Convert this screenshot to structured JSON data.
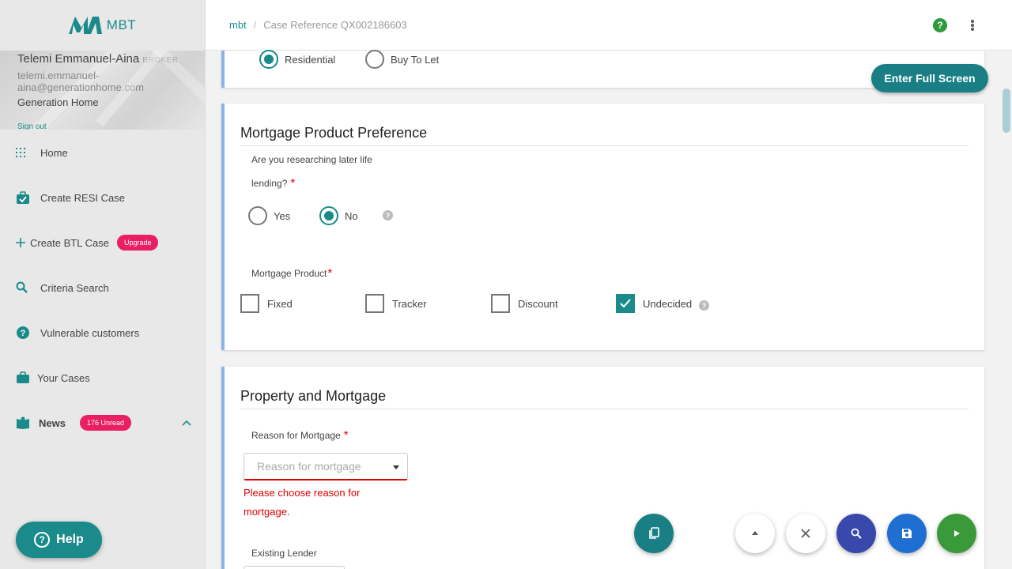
{
  "app": {
    "logo_text": "MBT"
  },
  "user": {
    "name": "Telemi Emmanuel-Aina",
    "role": "BROKER",
    "email": "telemi.emmanuel-aina@generationhome.com",
    "company": "Generation Home",
    "sign_out_label": "Sign out"
  },
  "sidebar": {
    "items": [
      {
        "label": "Home",
        "icon": "grid-icon"
      },
      {
        "label": "Create RESI Case",
        "icon": "briefcase-check-icon"
      },
      {
        "label": "Create BTL Case",
        "icon": "plus-icon",
        "badge": "Upgrade"
      },
      {
        "label": "Criteria Search",
        "icon": "search-icon"
      },
      {
        "label": "Vulnerable customers",
        "icon": "help-circle-icon"
      },
      {
        "label": "Your Cases",
        "icon": "briefcase-icon"
      },
      {
        "label": "News",
        "icon": "reader-icon",
        "badge": "176 Unread"
      }
    ],
    "help_label": "Help"
  },
  "header": {
    "breadcrumb_home": "mbt",
    "breadcrumb_sep": "/",
    "breadcrumb_case": "Case Reference QX002186603"
  },
  "property_type": {
    "options": [
      "Residential",
      "Buy To Let"
    ],
    "selected": "Residential"
  },
  "fullscreen_label": "Enter Full Screen",
  "product_pref": {
    "title": "Mortgage Product Preference",
    "later_life_question_line1": "Are you researching later life",
    "later_life_question_line2": "lending?",
    "required_mark": "*",
    "later_life_options": [
      "Yes",
      "No"
    ],
    "later_life_selected": "No",
    "product_label": "Mortgage Product",
    "product_options": [
      "Fixed",
      "Tracker",
      "Discount",
      "Undecided"
    ],
    "product_checked": [
      "Undecided"
    ]
  },
  "property": {
    "title": "Property and Mortgage",
    "reason_label": "Reason for Mortgage",
    "reason_placeholder": "Reason for mortgage",
    "reason_error": "Please choose reason for mortgage.",
    "lender_label": "Existing Lender"
  },
  "colors": {
    "accent": "#1a8a8a",
    "badge": "#e91e63",
    "error": "#dd0000",
    "card_border": "#8ab4e8"
  }
}
